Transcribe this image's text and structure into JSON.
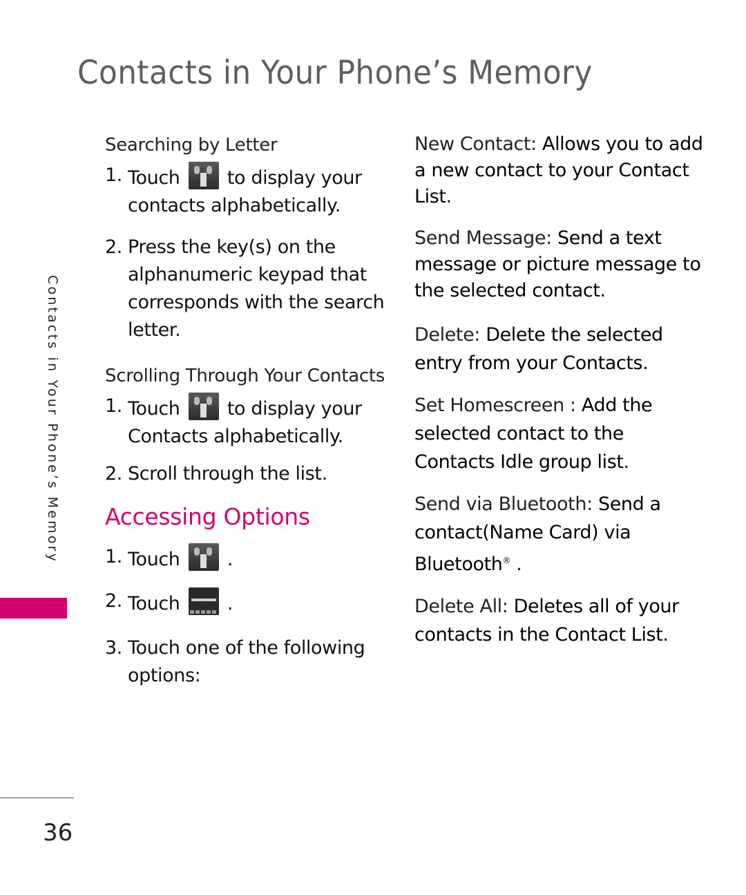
{
  "page": {
    "title": "Contacts in Your Phone’s Memory",
    "side_label": "Contacts in Your Phone’s Memory",
    "page_number": "36",
    "accent_color": "#d4006e"
  },
  "left": {
    "searching": {
      "subheading": "Searching by Letter",
      "steps": [
        {
          "num": "1.",
          "before": "Touch",
          "icon": "contacts-icon",
          "after": "to display your contacts alphabetically."
        },
        {
          "num": "2.",
          "text": "Press the key(s) on the alphanumeric keypad that corresponds with the search letter."
        }
      ]
    },
    "scrolling": {
      "subheading": "Scrolling Through Your Contacts",
      "steps": [
        {
          "num": "1.",
          "before": "Touch",
          "icon": "contacts-icon",
          "after": "to display your Contacts alphabetically."
        },
        {
          "num": "2.",
          "text": "Scroll through the list."
        }
      ]
    },
    "accessing": {
      "heading": "Accessing Options",
      "steps": [
        {
          "num": "1.",
          "before": "Touch",
          "icon": "contacts-icon",
          "after": "."
        },
        {
          "num": "2.",
          "before": "Touch",
          "icon": "options-menu-icon",
          "after": "."
        },
        {
          "num": "3.",
          "text": "Touch one of the following options:"
        }
      ]
    }
  },
  "options": [
    {
      "label": "New Contact:",
      "desc": "Allows you to add a new contact to your Contact List."
    },
    {
      "label": "Send Message:",
      "desc": "Send a text message or picture message to the selected contact."
    },
    {
      "label": "Delete:",
      "desc": "Delete the selected entry from your Contacts."
    },
    {
      "label": "Set Homescreen :",
      "desc": "Add the selected contact to the Contacts Idle group list."
    },
    {
      "label": "Send via Bluetooth:",
      "desc": "Send a contact(Name Card) via Bluetooth",
      "reg": "®",
      "end": " ."
    },
    {
      "label": "Delete All:",
      "desc": "Deletes all of your contacts in the Contact List."
    }
  ]
}
